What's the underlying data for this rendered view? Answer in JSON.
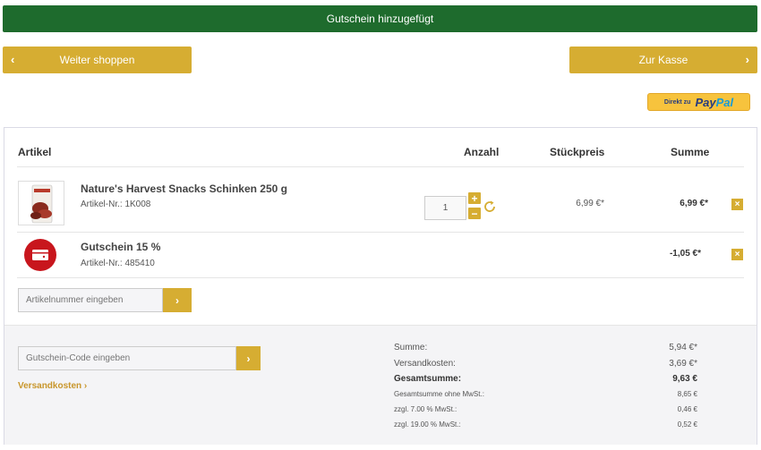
{
  "banner": {
    "text": "Gutschein hinzugefügt"
  },
  "nav": {
    "continue_label": "Weiter shoppen",
    "continue_chevron": "‹",
    "checkout_label": "Zur Kasse",
    "checkout_chevron": "›"
  },
  "paypal": {
    "prefix": "Direkt zu",
    "logo_pay": "Pay",
    "logo_pal": "Pal"
  },
  "table": {
    "headers": {
      "article": "Artikel",
      "quantity": "Anzahl",
      "unit_price": "Stückpreis",
      "total": "Summe"
    },
    "items": [
      {
        "name": "Nature's Harvest Snacks Schinken 250 g",
        "article_nr": "Artikel-Nr.: 1K008",
        "quantity": "1",
        "unit_price": "6,99 €*",
        "total": "6,99 €*",
        "icon": "product-image"
      },
      {
        "name": "Gutschein 15 %",
        "article_nr": "Artikel-Nr.: 485410",
        "total": "-1,05 €*",
        "icon": "voucher-icon"
      }
    ],
    "delete_glyph": "×",
    "plus_glyph": "+",
    "minus_glyph": "−"
  },
  "article_input": {
    "placeholder": "Artikelnummer eingeben",
    "go": "›"
  },
  "voucher_input": {
    "placeholder": "Gutschein-Code eingeben",
    "go": "›"
  },
  "shipping_link": "Versandkosten ›",
  "summary": {
    "subtotal_label": "Summe:",
    "subtotal": "5,94 €*",
    "shipping_label": "Versandkosten:",
    "shipping": "3,69 €*",
    "grand_label": "Gesamtsumme:",
    "grand": "9,63 €",
    "net_label": "Gesamtsumme ohne MwSt.:",
    "net": "8,65 €",
    "vat7_label": "zzgl. 7.00 % MwSt.:",
    "vat7": "0,46 €",
    "vat19_label": "zzgl. 19.00 % MwSt.:",
    "vat19": "0,52 €"
  },
  "colors": {
    "banner": "#1e6b2d",
    "accent": "#d6ad32",
    "voucher": "#c8161d"
  }
}
